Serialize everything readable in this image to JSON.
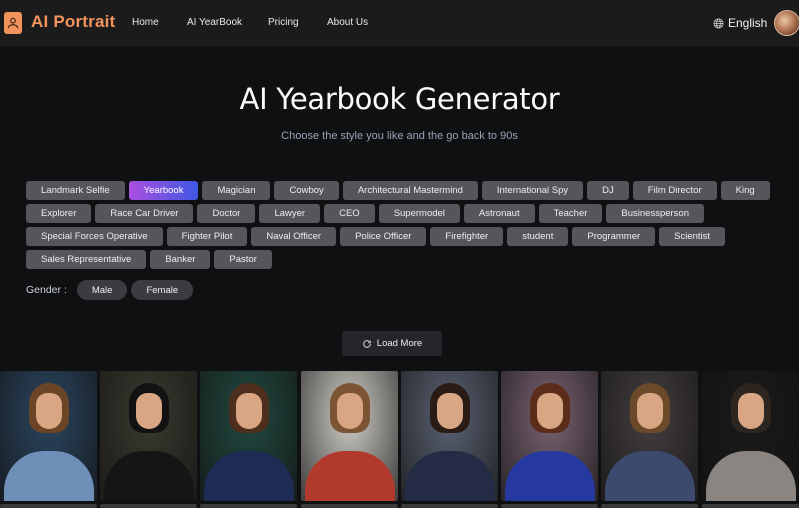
{
  "header": {
    "brand": "AI Portrait",
    "logo_icon": "user-icon",
    "nav": [
      {
        "label": "Home"
      },
      {
        "label": "AI YearBook"
      },
      {
        "label": "Pricing"
      },
      {
        "label": "About Us"
      }
    ],
    "language": {
      "icon": "globe-icon",
      "label": "English"
    },
    "avatar": "user-avatar"
  },
  "hero": {
    "title": "AI Yearbook Generator",
    "subtitle": "Choose the style you like and the go back to 90s"
  },
  "styles": {
    "selected": "Yearbook",
    "items": [
      {
        "label": "Landmark Selfie"
      },
      {
        "label": "Yearbook",
        "active": true
      },
      {
        "label": "Magician"
      },
      {
        "label": "Cowboy"
      },
      {
        "label": "Architectural Mastermind"
      },
      {
        "label": "International Spy"
      },
      {
        "label": "DJ"
      },
      {
        "label": "Film Director"
      },
      {
        "label": "King"
      },
      {
        "label": "Explorer"
      },
      {
        "label": "Race Car Driver"
      },
      {
        "label": "Doctor"
      },
      {
        "label": "Lawyer"
      },
      {
        "label": "CEO"
      },
      {
        "label": "Supermodel"
      },
      {
        "label": "Astronaut"
      },
      {
        "label": "Teacher"
      },
      {
        "label": "Businessperson"
      },
      {
        "label": "Special Forces Operative"
      },
      {
        "label": "Fighter Pilot"
      },
      {
        "label": "Naval Officer"
      },
      {
        "label": "Police Officer"
      },
      {
        "label": "Firefighter"
      },
      {
        "label": "student"
      },
      {
        "label": "Programmer"
      },
      {
        "label": "Scientist"
      },
      {
        "label": "Sales Representative"
      },
      {
        "label": "Banker"
      },
      {
        "label": "Pastor"
      }
    ]
  },
  "gender": {
    "label": "Gender :",
    "options": [
      {
        "label": "Male"
      },
      {
        "label": "Female"
      }
    ]
  },
  "load_more": {
    "icon": "refresh-icon",
    "label": "Load More"
  },
  "gallery": {
    "items": [
      {
        "name": "yearbook-photo-sweater-boy",
        "bg": "#2b4560",
        "shirt": "#6f8fb8",
        "hair": "#6b4526"
      },
      {
        "name": "yearbook-photo-dark-hair-girl",
        "bg": "#3a3a30",
        "shirt": "#151515",
        "hair": "#121212"
      },
      {
        "name": "yearbook-photo-glasses-girl",
        "bg": "#21483f",
        "shirt": "#1d2b55",
        "hair": "#4e2e1c"
      },
      {
        "name": "yearbook-photo-framed-girl",
        "bg": "#cfcdc6",
        "shirt": "#b23a2c",
        "hair": "#7c5434"
      },
      {
        "name": "yearbook-photo-suit-boy",
        "bg": "#5a6272",
        "shirt": "#232c44",
        "hair": "#2a1b14"
      },
      {
        "name": "yearbook-photo-cheerleader",
        "bg": "#7a6372",
        "shirt": "#2639a0",
        "hair": "#5b2c1a"
      },
      {
        "name": "yearbook-photo-blazer-boy",
        "bg": "#443e40",
        "shirt": "#3c4a6e",
        "hair": "#6b4a2a"
      },
      {
        "name": "yearbook-photo-cellist",
        "bg": "#1a1a1a",
        "shirt": "#8a8580",
        "hair": "#2d2520"
      }
    ]
  },
  "colors": {
    "accent": "#f2935b",
    "chip": "#55565a",
    "active_start": "#a94fe0",
    "active_end": "#3f58e3",
    "background": "#0f1012"
  }
}
